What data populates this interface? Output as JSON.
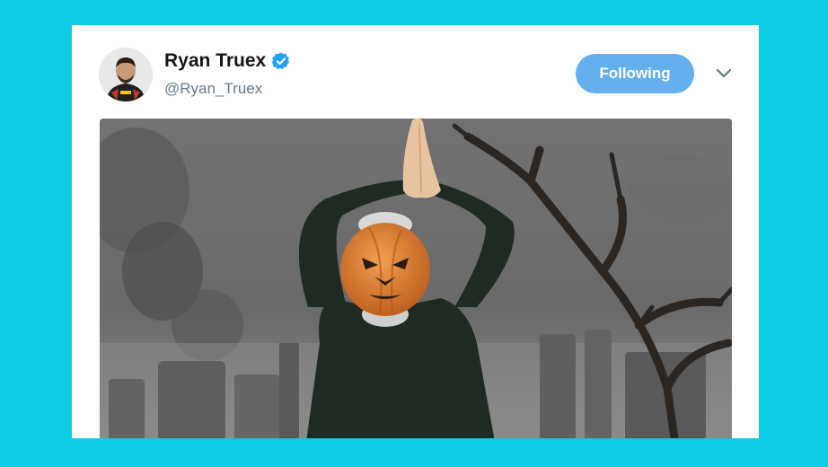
{
  "tweet": {
    "author": {
      "name": "Ryan Truex",
      "handle": "@Ryan_Truex",
      "verified": true
    },
    "follow_button_label": "Following",
    "media": {
      "kind": "animated-gif",
      "description_icon": "pumpkin-head-dancer-image"
    }
  },
  "colors": {
    "background": "#0ccbe3",
    "card": "#ffffff",
    "follow_button": "#64b0ee",
    "name_text": "#14171a",
    "handle_text": "#657786",
    "verified_badge": "#1da1f2"
  },
  "icons": {
    "verified": "verified-badge-icon",
    "caret": "chevron-down-icon"
  }
}
